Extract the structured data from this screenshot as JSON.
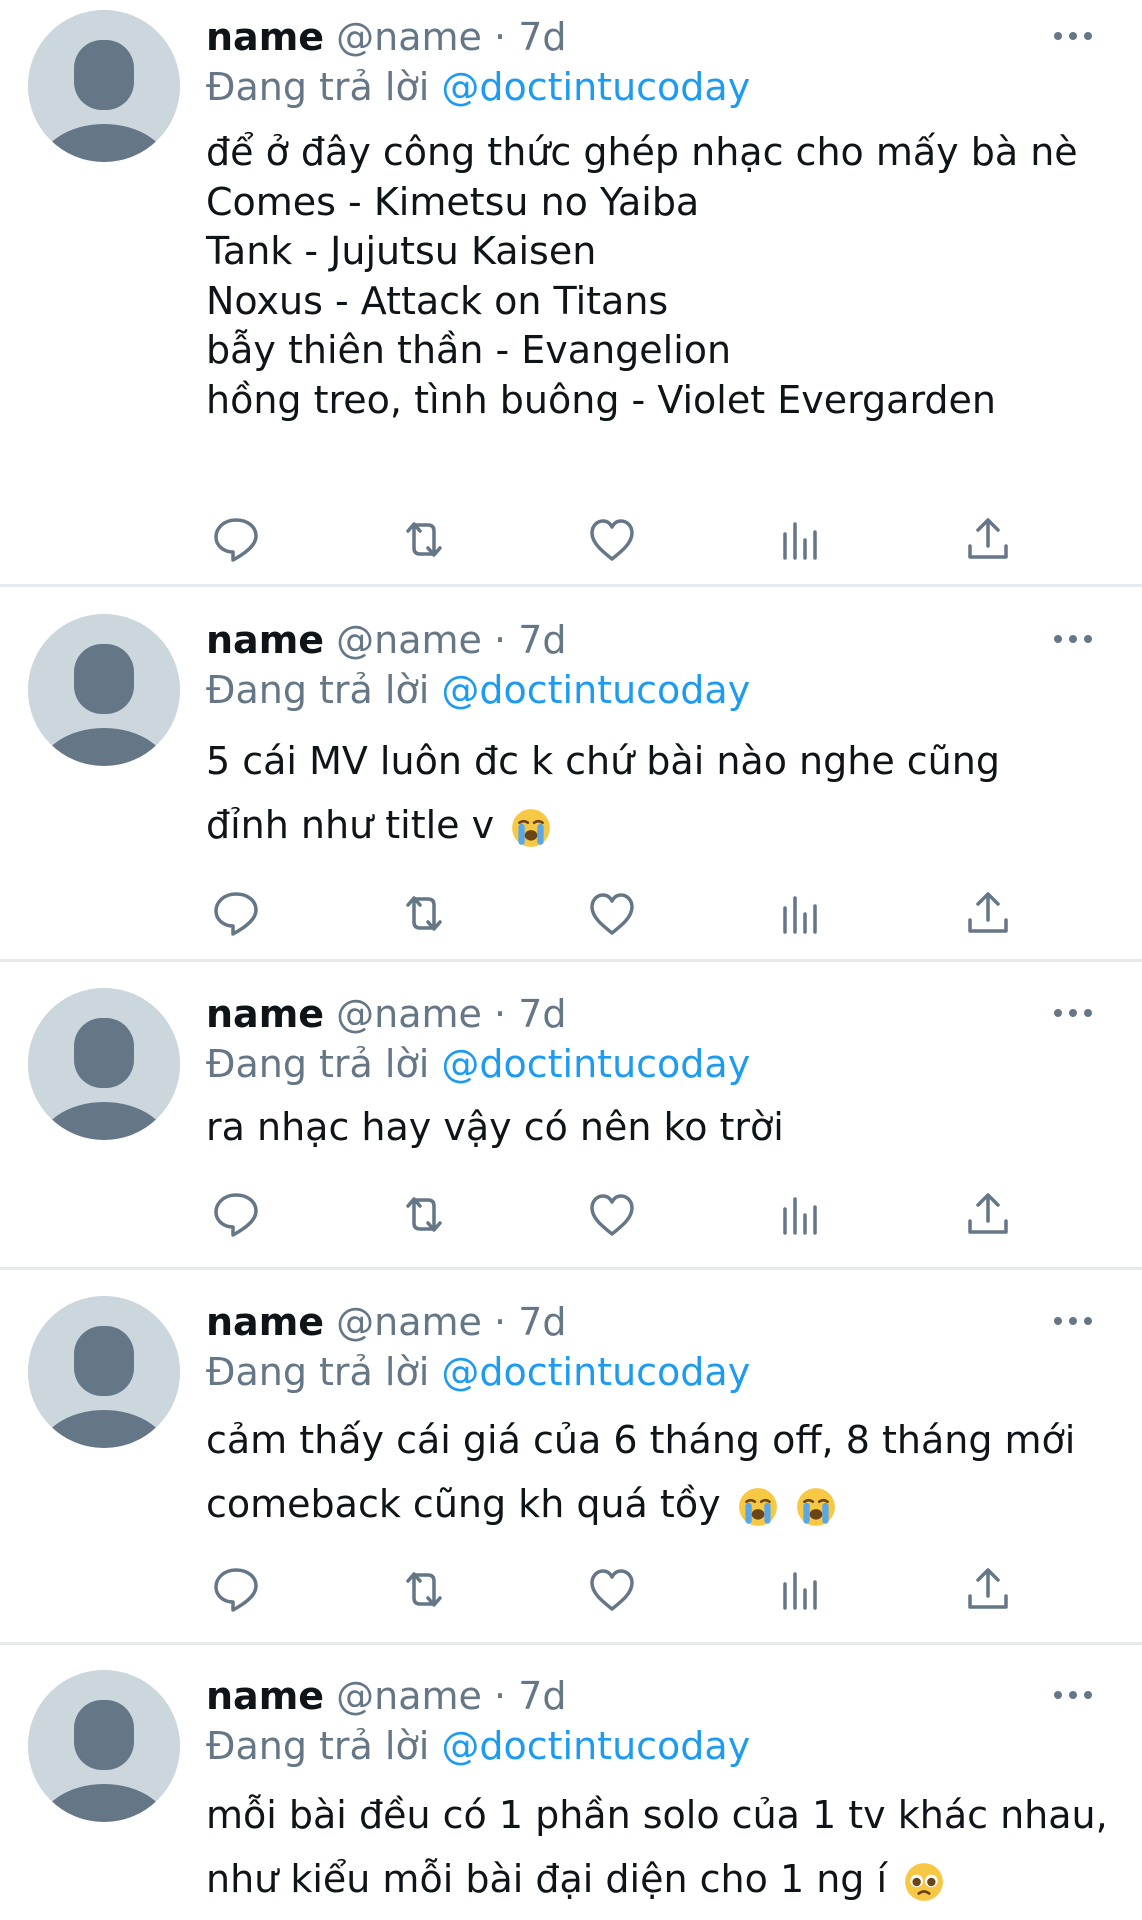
{
  "tweets": [
    {
      "author_name": "name",
      "author_handle": "@name",
      "time": "7d",
      "separator": "·",
      "reply_label": "Đang trả lời",
      "reply_to": "@doctintucoday",
      "lines": [
        "để ở đây công thức ghép nhạc cho mấy bà nè",
        "Comes - Kimetsu no Yaiba",
        "Tank - Jujutsu Kaisen",
        "Noxus - Attack on Titans",
        "bẫy thiên thần - Evangelion",
        "hồng treo, tình buông - Violet Evergarden"
      ]
    },
    {
      "author_name": "name",
      "author_handle": "@name",
      "time": "7d",
      "separator": "·",
      "reply_label": "Đang trả lời",
      "reply_to": "@doctintucoday",
      "lines": [
        "5 cái MV luôn đc k chứ bài nào nghe cũng",
        "đỉnh như title v"
      ],
      "emojis": [
        "loudly-crying-face-emoji"
      ]
    },
    {
      "author_name": "name",
      "author_handle": "@name",
      "time": "7d",
      "separator": "·",
      "reply_label": "Đang trả lời",
      "reply_to": "@doctintucoday",
      "lines": [
        "ra nhạc hay vậy có nên ko trời"
      ]
    },
    {
      "author_name": "name",
      "author_handle": "@name",
      "time": "7d",
      "separator": "·",
      "reply_label": "Đang trả lời",
      "reply_to": "@doctintucoday",
      "lines": [
        "cảm thấy cái giá của 6 tháng off, 8 tháng mới",
        "comeback cũng kh quá tồy"
      ],
      "emojis": [
        "loudly-crying-face-emoji",
        "loudly-crying-face-emoji"
      ]
    },
    {
      "author_name": "name",
      "author_handle": "@name",
      "time": "7d",
      "separator": "·",
      "reply_label": "Đang trả lời",
      "reply_to": "@doctintucoday",
      "lines": [
        "mỗi bài đều có 1 phần solo của 1 tv khác nhau,",
        "như kiểu mỗi bài đại diện cho 1 ng í"
      ],
      "emojis": [
        "pleading-face-emoji"
      ]
    }
  ],
  "action_icons": [
    "reply-icon",
    "retweet-icon",
    "like-icon",
    "analytics-icon",
    "share-icon"
  ],
  "colors": {
    "text": "#0f1419",
    "secondary": "#657786",
    "link": "#1d9bf0",
    "avatar_bg": "#ccd6dd",
    "avatar_fg": "#657786",
    "divider": "#e7eaed"
  }
}
